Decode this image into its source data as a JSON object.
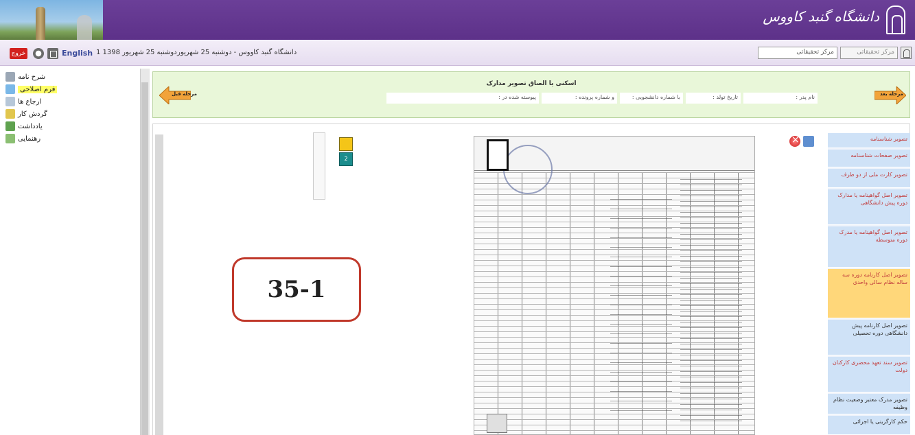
{
  "banner": {
    "title": "دانشگاه گنبد کاووس"
  },
  "toolbar": {
    "exit_label": "خروج",
    "english_label": "English",
    "date_text": "1 1398 دوشنبه 25 شهریور",
    "title": "دانشگاه گنبد کاووس - دوشنبه 25 شهریور",
    "search_placeholder": "مرکز تحقیقاتی",
    "select_value": "مرکز تحقیقاتی"
  },
  "nav": {
    "items": [
      {
        "label": "شرح نامه"
      },
      {
        "label": "فرم اصلاحی"
      },
      {
        "label": "ارجاع ها"
      },
      {
        "label": "گردش کار"
      },
      {
        "label": "یادداشت"
      },
      {
        "label": "رهنمایی"
      }
    ]
  },
  "form_header": {
    "title": "اسکنی یا الصاق تصویر مدارک",
    "fields": [
      {
        "label": "نام پدر :"
      },
      {
        "label": "تاریخ تولد :"
      },
      {
        "label": "با شماره دانشجویی :"
      },
      {
        "label": "و شماره پرونده :"
      },
      {
        "label": "پیوسته شده در :"
      }
    ],
    "prev_label": "مرحله قبل",
    "next_label": "مرحله بعد"
  },
  "viewer": {
    "page_label": "2",
    "callout": "35-1"
  },
  "right_list": {
    "items": [
      {
        "label": "تصویر شناسنامه"
      },
      {
        "label": "تصویر صفحات شناسنامه"
      },
      {
        "label": "تصویر کارت ملی از دو طرف"
      },
      {
        "label": "تصویر اصل گواهینامه یا مدارک دوره پیش دانشگاهی"
      },
      {
        "label": "تصویر اصل گواهینامه یا مدرک دوره متوسطه"
      },
      {
        "label": "تصویر اصل کارنامه دوره سه ساله نظام سالی واحدی"
      },
      {
        "label": "تصویر اصل کارنامه پیش دانشگاهی دوره تحصیلی"
      },
      {
        "label": "تصویر سند تعهد محضری کارکنان دولت"
      },
      {
        "label": "تصویر مدرک معتبر وضعیت نظام وظیفه"
      },
      {
        "label": "حکم کارگزینی یا اجرائی"
      }
    ]
  },
  "colors": {
    "banner": "#5d3189",
    "exit": "#d2211e",
    "header_bg": "#e9f7d9",
    "callout_border": "#c0392b"
  }
}
